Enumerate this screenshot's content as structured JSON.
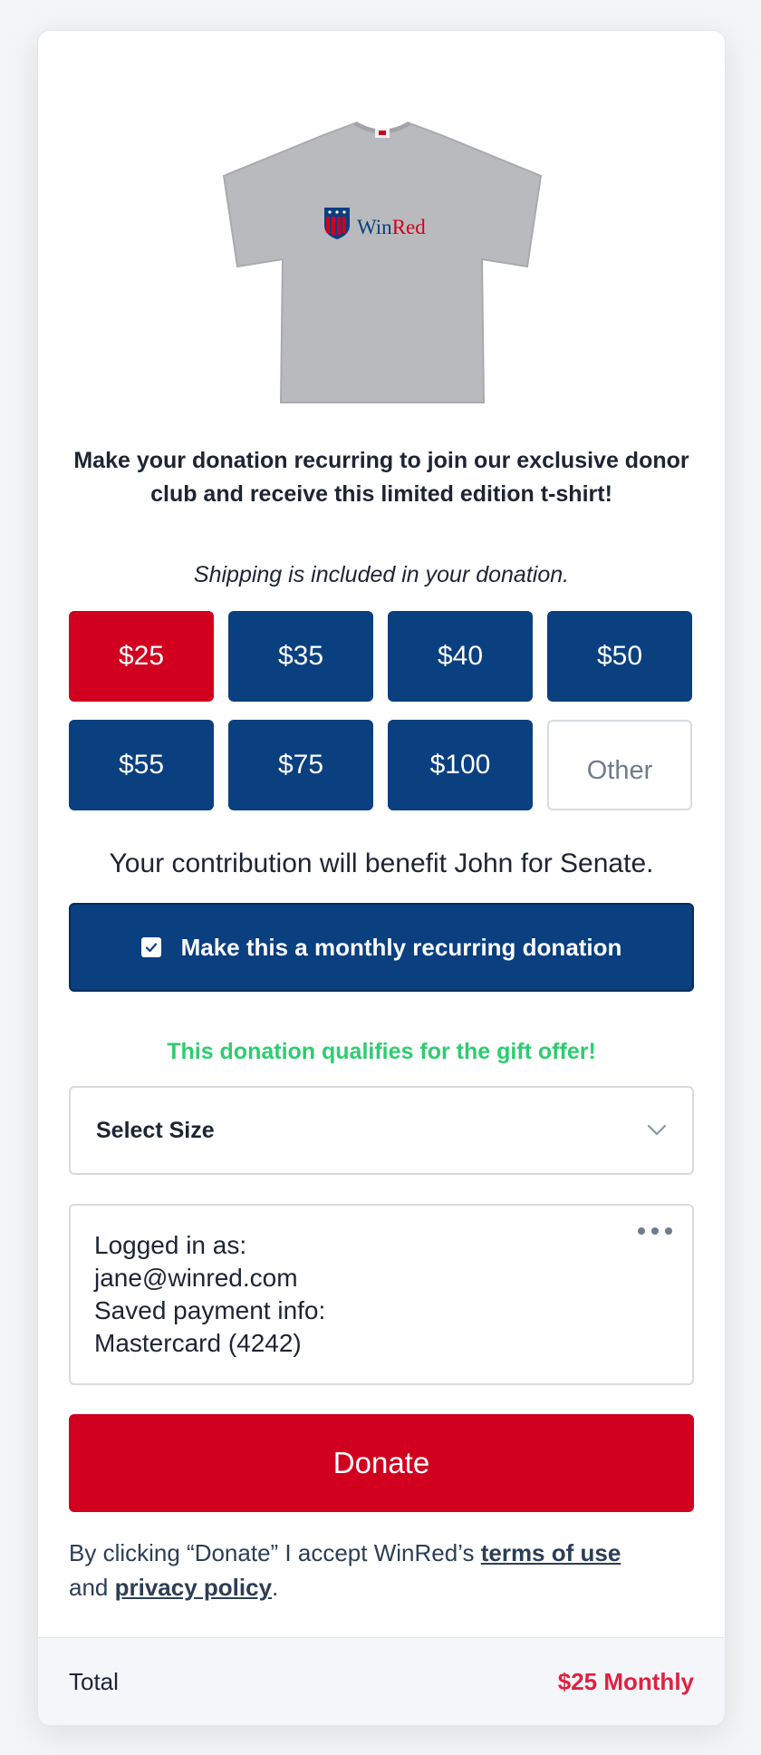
{
  "product": {
    "image_alt": "Gray t-shirt with WinRed logo",
    "logo_text": "WinRed"
  },
  "promo": {
    "line1": "Make your donation recurring to join our exclusive donor",
    "line2": "club and receive this limited edition t-shirt!"
  },
  "shipping_note": "Shipping is included in your donation.",
  "amounts": [
    {
      "label": "$25",
      "selected": true
    },
    {
      "label": "$35",
      "selected": false
    },
    {
      "label": "$40",
      "selected": false
    },
    {
      "label": "$50",
      "selected": false
    },
    {
      "label": "$55",
      "selected": false
    },
    {
      "label": "$75",
      "selected": false
    },
    {
      "label": "$100",
      "selected": false
    }
  ],
  "other_placeholder": "Other",
  "benefit_text": "Your contribution will benefit John for Senate.",
  "recurring": {
    "label": "Make this a monthly recurring donation",
    "checked": true
  },
  "qualifies_text": "This donation qualifies for the gift offer!",
  "size_select": {
    "label": "Select Size"
  },
  "account": {
    "logged_in_label": "Logged in as:",
    "email": "jane@winred.com",
    "payment_label": "Saved payment info:",
    "card": "Mastercard (4242)"
  },
  "donate_label": "Donate",
  "terms": {
    "prefix": "By clicking “Donate” I accept WinRed’s ",
    "terms_link": "terms of use",
    "and": "and ",
    "privacy_link": "privacy policy",
    "suffix": "."
  },
  "footer": {
    "total_label": "Total",
    "total_value": "$25 Monthly"
  },
  "colors": {
    "brand_red": "#d1001f",
    "brand_navy": "#0a3f80",
    "success_green": "#2ecc71"
  }
}
